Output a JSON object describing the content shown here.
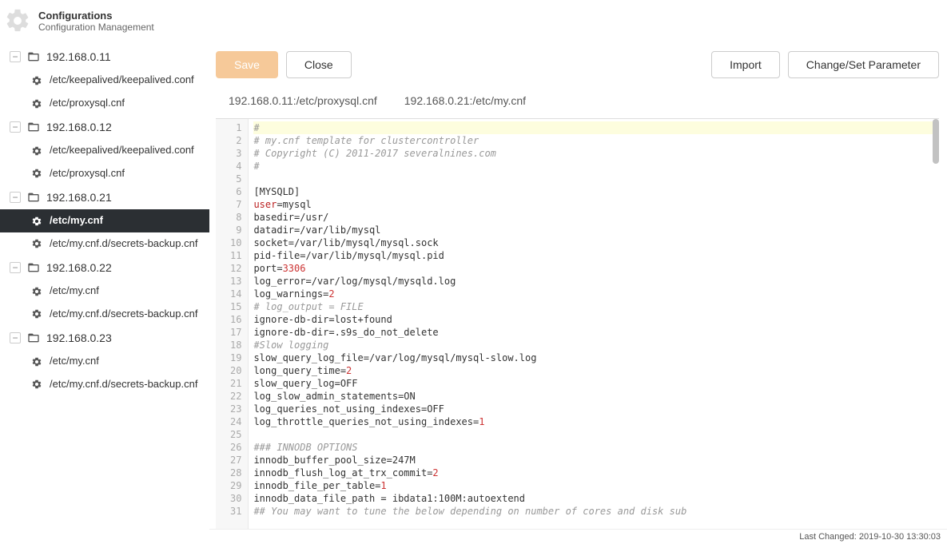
{
  "header": {
    "title": "Configurations",
    "subtitle": "Configuration Management"
  },
  "toolbar": {
    "save": "Save",
    "close": "Close",
    "import": "Import",
    "change_param": "Change/Set Parameter"
  },
  "tabs": [
    {
      "label": "192.168.0.11:/etc/proxysql.cnf"
    },
    {
      "label": "192.168.0.21:/etc/my.cnf"
    }
  ],
  "sidebar": {
    "hosts": [
      {
        "ip": "192.168.0.11",
        "files": [
          "/etc/keepalived/keepalived.conf",
          "/etc/proxysql.cnf"
        ]
      },
      {
        "ip": "192.168.0.12",
        "files": [
          "/etc/keepalived/keepalived.conf",
          "/etc/proxysql.cnf"
        ]
      },
      {
        "ip": "192.168.0.21",
        "files": [
          "/etc/my.cnf",
          "/etc/my.cnf.d/secrets-backup.cnf"
        ],
        "active_file": 0
      },
      {
        "ip": "192.168.0.22",
        "files": [
          "/etc/my.cnf",
          "/etc/my.cnf.d/secrets-backup.cnf"
        ]
      },
      {
        "ip": "192.168.0.23",
        "files": [
          "/etc/my.cnf",
          "/etc/my.cnf.d/secrets-backup.cnf"
        ]
      }
    ]
  },
  "editor": {
    "lines": [
      {
        "n": 1,
        "hl": true,
        "parts": [
          {
            "t": "#",
            "c": "comment"
          }
        ]
      },
      {
        "n": 2,
        "parts": [
          {
            "t": "# my.cnf template for clustercontroller",
            "c": "comment"
          }
        ]
      },
      {
        "n": 3,
        "parts": [
          {
            "t": "# Copyright (C) 2011-2017 severalnines.com",
            "c": "comment"
          }
        ]
      },
      {
        "n": 4,
        "parts": [
          {
            "t": "#",
            "c": "comment"
          }
        ]
      },
      {
        "n": 5,
        "parts": [
          {
            "t": ""
          }
        ]
      },
      {
        "n": 6,
        "parts": [
          {
            "t": "[MYSQLD]"
          }
        ]
      },
      {
        "n": 7,
        "parts": [
          {
            "t": "user",
            "c": "key"
          },
          {
            "t": "=mysql"
          }
        ]
      },
      {
        "n": 8,
        "parts": [
          {
            "t": "basedir=/usr/"
          }
        ]
      },
      {
        "n": 9,
        "parts": [
          {
            "t": "datadir=/var/lib/mysql"
          }
        ]
      },
      {
        "n": 10,
        "parts": [
          {
            "t": "socket=/var/lib/mysql/mysql.sock"
          }
        ]
      },
      {
        "n": 11,
        "parts": [
          {
            "t": "pid-file=/var/lib/mysql/mysql.pid"
          }
        ]
      },
      {
        "n": 12,
        "parts": [
          {
            "t": "port="
          },
          {
            "t": "3306",
            "c": "num"
          }
        ]
      },
      {
        "n": 13,
        "parts": [
          {
            "t": "log_error=/var/log/mysql/mysqld.log"
          }
        ]
      },
      {
        "n": 14,
        "parts": [
          {
            "t": "log_warnings="
          },
          {
            "t": "2",
            "c": "num"
          }
        ]
      },
      {
        "n": 15,
        "parts": [
          {
            "t": "# log_output = FILE",
            "c": "comment"
          }
        ]
      },
      {
        "n": 16,
        "parts": [
          {
            "t": "ignore-db-dir=lost+found"
          }
        ]
      },
      {
        "n": 17,
        "parts": [
          {
            "t": "ignore-db-dir=.s9s_do_not_delete"
          }
        ]
      },
      {
        "n": 18,
        "parts": [
          {
            "t": "#Slow logging",
            "c": "comment"
          }
        ]
      },
      {
        "n": 19,
        "parts": [
          {
            "t": "slow_query_log_file=/var/log/mysql/mysql-slow.log"
          }
        ]
      },
      {
        "n": 20,
        "parts": [
          {
            "t": "long_query_time="
          },
          {
            "t": "2",
            "c": "num"
          }
        ]
      },
      {
        "n": 21,
        "parts": [
          {
            "t": "slow_query_log=OFF"
          }
        ]
      },
      {
        "n": 22,
        "parts": [
          {
            "t": "log_slow_admin_statements=ON"
          }
        ]
      },
      {
        "n": 23,
        "parts": [
          {
            "t": "log_queries_not_using_indexes=OFF"
          }
        ]
      },
      {
        "n": 24,
        "parts": [
          {
            "t": "log_throttle_queries_not_using_indexes="
          },
          {
            "t": "1",
            "c": "num"
          }
        ]
      },
      {
        "n": 25,
        "parts": [
          {
            "t": ""
          }
        ]
      },
      {
        "n": 26,
        "parts": [
          {
            "t": "### INNODB OPTIONS",
            "c": "comment"
          }
        ]
      },
      {
        "n": 27,
        "parts": [
          {
            "t": "innodb_buffer_pool_size=247M"
          }
        ]
      },
      {
        "n": 28,
        "parts": [
          {
            "t": "innodb_flush_log_at_trx_commit="
          },
          {
            "t": "2",
            "c": "num"
          }
        ]
      },
      {
        "n": 29,
        "parts": [
          {
            "t": "innodb_file_per_table="
          },
          {
            "t": "1",
            "c": "num"
          }
        ]
      },
      {
        "n": 30,
        "parts": [
          {
            "t": "innodb_data_file_path = ibdata1:100M:autoextend"
          }
        ]
      },
      {
        "n": 31,
        "parts": [
          {
            "t": "## You may want to tune the below depending on number of cores and disk sub",
            "c": "comment"
          }
        ]
      }
    ]
  },
  "status": {
    "last_changed_label": "Last Changed:",
    "last_changed_value": "2019-10-30 13:30:03"
  }
}
